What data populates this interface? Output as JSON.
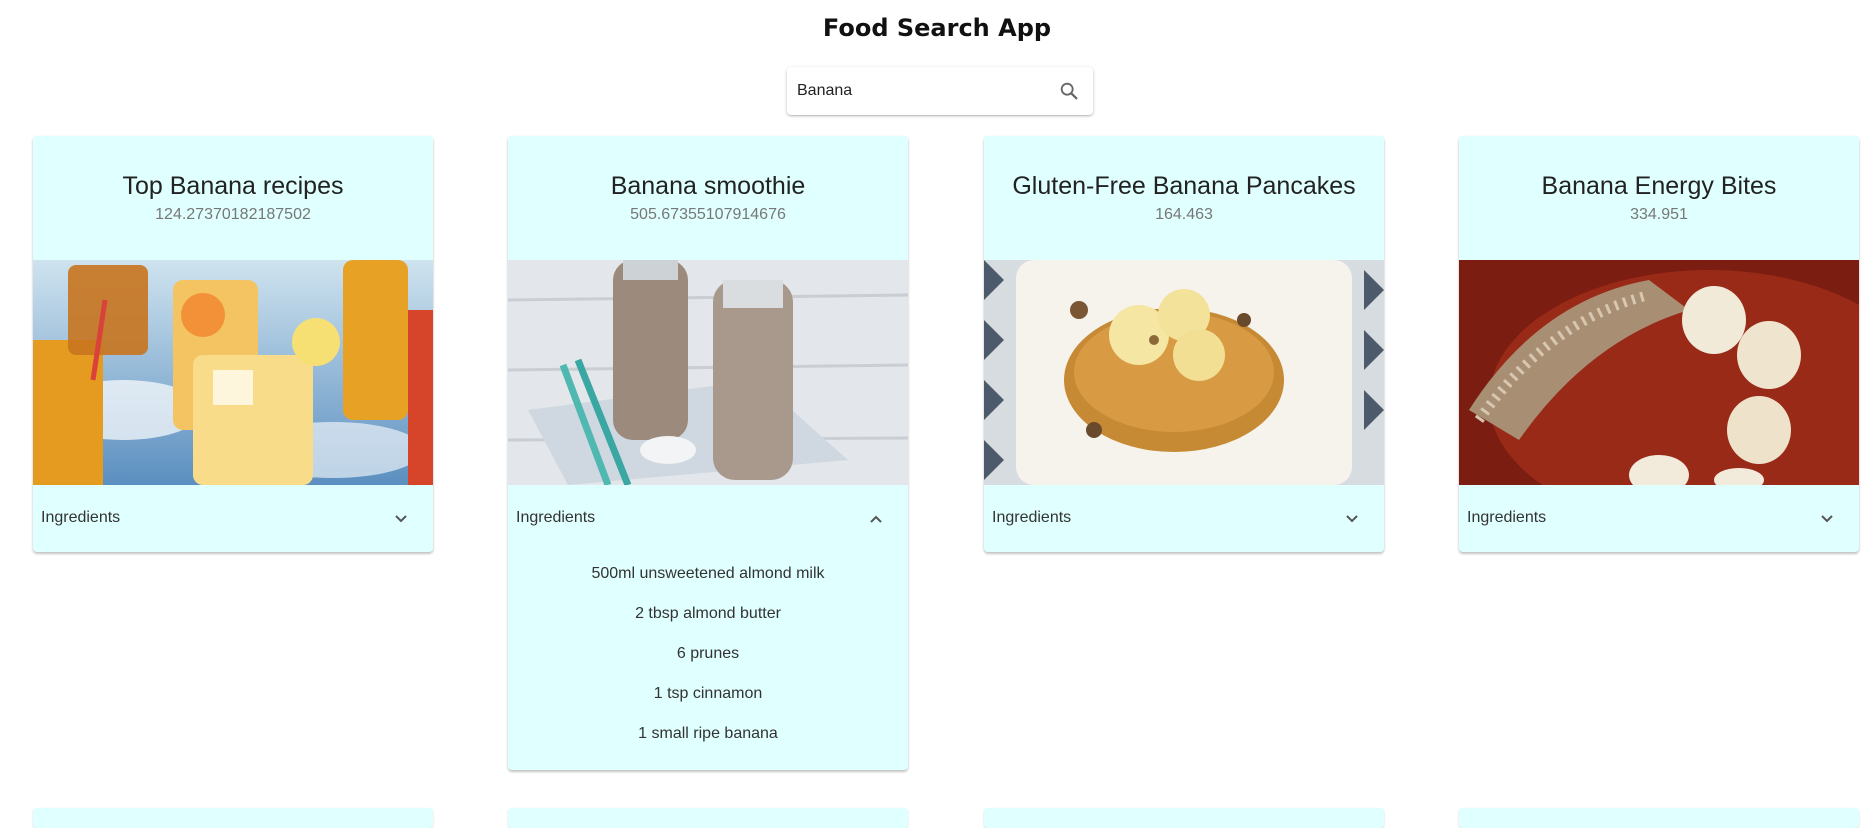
{
  "app": {
    "title": "Food Search App"
  },
  "search": {
    "value": "Banana",
    "icon": "search-icon"
  },
  "accent_color": "#e0ffff",
  "cards": [
    {
      "title": "Top Banana recipes",
      "subtitle": "124.27370182187502",
      "image": "iced-tea-drinks-photo",
      "accordion_label": "Ingredients",
      "expanded": false
    },
    {
      "title": "Banana smoothie",
      "subtitle": "505.67355107914676",
      "image": "smoothie-bottles-photo",
      "accordion_label": "Ingredients",
      "expanded": true,
      "ingredients": [
        "500ml unsweetened almond milk",
        "2 tbsp almond butter",
        "6 prunes",
        "1 tsp cinnamon",
        "1 small ripe banana"
      ]
    },
    {
      "title": "Gluten-Free Banana Pancakes",
      "subtitle": "164.463",
      "image": "banana-pancakes-photo",
      "accordion_label": "Ingredients",
      "expanded": false
    },
    {
      "title": "Banana Energy Bites",
      "subtitle": "334.951",
      "image": "banana-energy-bites-photo",
      "accordion_label": "Ingredients",
      "expanded": false
    }
  ]
}
